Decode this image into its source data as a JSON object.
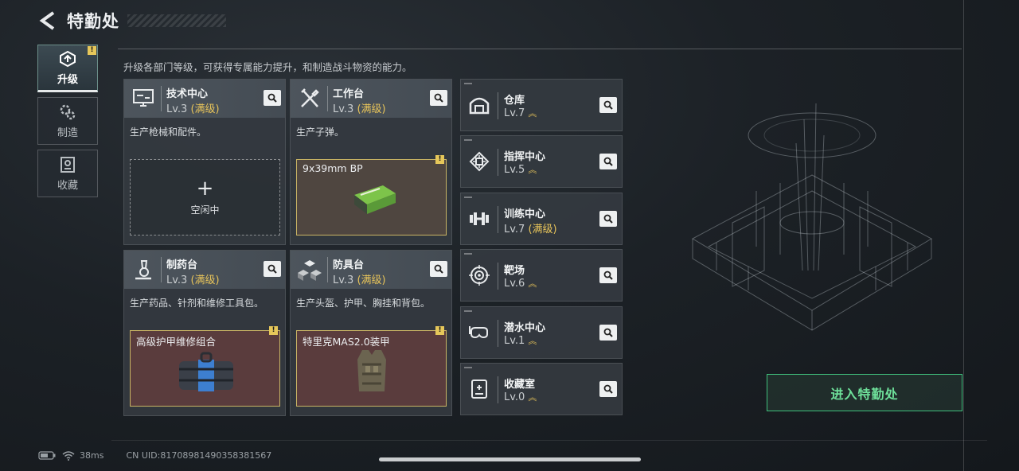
{
  "header": {
    "title": "特勤处",
    "subtitle": "升级各部门等级，可获得专属能力提升，和制造战斗物资的能力。"
  },
  "nav": [
    {
      "label": "升级",
      "active": true,
      "badge": "!"
    },
    {
      "label": "制造"
    },
    {
      "label": "收藏"
    }
  ],
  "cards": [
    {
      "name": "技术中心",
      "level": "Lv.3",
      "max": "(满级)",
      "desc": "生产枪械和配件。",
      "slot_empty": "空闲中"
    },
    {
      "name": "工作台",
      "level": "Lv.3",
      "max": "(满级)",
      "desc": "生产子弹。",
      "item": "9x39mm BP",
      "badge": "!"
    },
    {
      "name": "制药台",
      "level": "Lv.3",
      "max": "(满级)",
      "desc": "生产药品、针剂和维修工具包。",
      "item": "高级护甲维修组合",
      "badge": "!"
    },
    {
      "name": "防具台",
      "level": "Lv.3",
      "max": "(满级)",
      "desc": "生产头盔、护甲、胸挂和背包。",
      "item": "特里克MAS2.0装甲",
      "badge": "!"
    }
  ],
  "rooms": [
    {
      "name": "仓库",
      "level": "Lv.7",
      "upgrade": "^^"
    },
    {
      "name": "指挥中心",
      "level": "Lv.5",
      "upgrade": "^^"
    },
    {
      "name": "训练中心",
      "level": "Lv.7",
      "max": "(满级)"
    },
    {
      "name": "靶场",
      "level": "Lv.6",
      "upgrade": "^^"
    },
    {
      "name": "潜水中心",
      "level": "Lv.1",
      "upgrade": "^^"
    },
    {
      "name": "收藏室",
      "level": "Lv.0",
      "upgrade": "^^"
    }
  ],
  "enter_button": "进入特勤处",
  "status": {
    "ping": "38ms",
    "uid": "CN UID:817089814903583815​67"
  },
  "colors": {
    "accent_green": "#3fbf7c",
    "max_gold": "#e6c35a",
    "badge_yellow": "#e6c75a"
  }
}
